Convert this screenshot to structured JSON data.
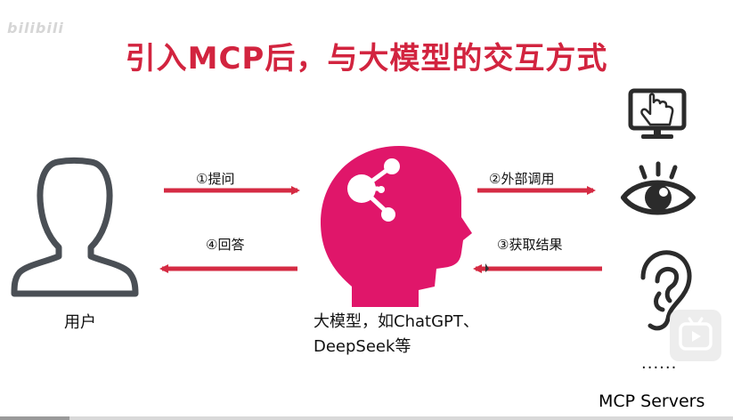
{
  "watermark": "bilibili",
  "title": "引入MCP后，与大模型的交互方式",
  "user_label": "用户",
  "model_caption_line1": "大模型，如ChatGPT、",
  "model_caption_line2": "DeepSeek等",
  "servers_label": "MCP Servers",
  "servers_more": "......",
  "arrows": {
    "step1": "①提问",
    "step2": "②外部调用",
    "step3": "③获取结果",
    "step4": "④回答"
  },
  "icons": [
    "user-icon",
    "brain-head-icon",
    "touch-screen-icon",
    "eye-icon",
    "ear-icon",
    "play-icon"
  ],
  "colors": {
    "title": "#d2243f",
    "arrow": "#d52b43",
    "head": "#e0166a",
    "icon_dark": "#2b2b2b",
    "user_icon": "#4a4f55"
  },
  "video_progress_fraction": 0.095
}
